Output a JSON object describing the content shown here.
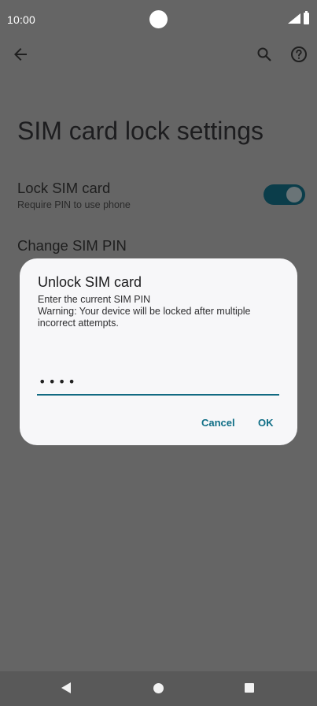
{
  "status_bar": {
    "time": "10:00"
  },
  "app_bar": {
    "back_icon": "arrow-left-icon",
    "search_icon": "search-icon",
    "help_icon": "help-circle-icon"
  },
  "page": {
    "title": "SIM card lock settings"
  },
  "settings": [
    {
      "title": "Lock SIM card",
      "summary": "Require PIN to use phone",
      "toggle_on": true
    },
    {
      "title": "Change SIM PIN"
    }
  ],
  "dialog": {
    "title": "Unlock SIM card",
    "message_line1": "Enter the current SIM PIN",
    "message_line2": "Warning: Your device will be locked after multiple incorrect attempts.",
    "pin_masked": "••••",
    "cancel_label": "Cancel",
    "ok_label": "OK"
  },
  "colors": {
    "accent": "#126a82",
    "toggle_track": "#0b3d4a",
    "scrim_background": "#656565",
    "dialog_background": "#f7f7f9"
  }
}
